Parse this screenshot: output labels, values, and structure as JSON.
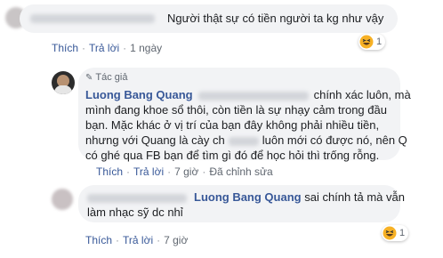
{
  "comments": [
    {
      "text": "Người thật sự có tiền người ta kg như vậy",
      "actions": {
        "like": "Thích",
        "reply": "Trả lời",
        "time": "1 ngày"
      },
      "reaction_count": "1",
      "reaction_icon": "haha-emoji-icon"
    },
    {
      "author_badge": "Tác giả",
      "author": "Luong Bang Quang",
      "text_lines": [
        "chính xác luôn, mà",
        "mình đang khoe sổ thôi, còn tiền là sự nhạy cảm trong đầu",
        "bạn. Mặc khác ở vị trí của bạn đây không phải nhiều tiền,",
        "nhưng với Quang là cày ch",
        "luôn mới có được nó, nên Q",
        "có ghé qua FB bạn để tìm gì đó để học hỏi thì trống rỗng."
      ],
      "actions": {
        "like": "Thích",
        "reply": "Trả lời",
        "time": "7 giờ",
        "edited": "Đã chỉnh sửa"
      }
    },
    {
      "mention": "Luong Bang Quang",
      "text_line1": "sai chính tả mà vẫn",
      "text_line2": "làm nhạc sỹ dc nhỉ",
      "actions": {
        "like": "Thích",
        "reply": "Trả lời",
        "time": "7 giờ"
      },
      "reaction_count": "1",
      "reaction_icon": "haha-emoji-icon"
    }
  ],
  "colors": {
    "link": "#385898",
    "bubble": "#f2f3f5",
    "meta": "#606770",
    "emoji": "#f7b125"
  }
}
